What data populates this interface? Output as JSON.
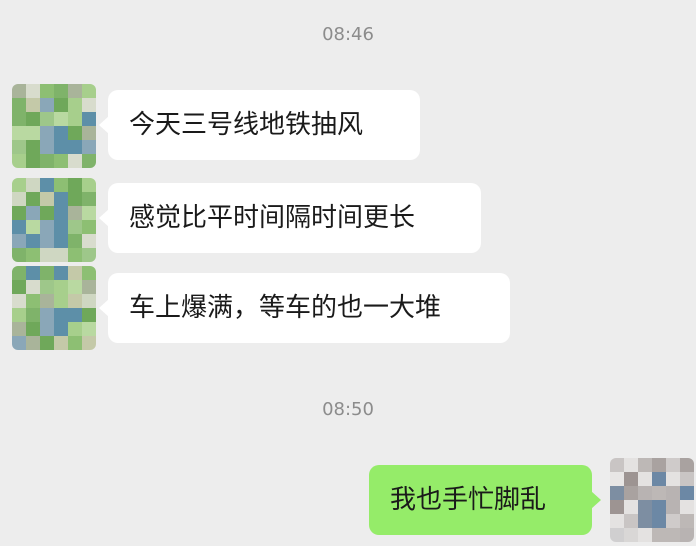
{
  "chat": {
    "timestamps": [
      "08:46",
      "08:50"
    ],
    "messages": [
      {
        "sender": "other",
        "text": "今天三号线地铁抽风"
      },
      {
        "sender": "other",
        "text": "感觉比平时间隔时间更长"
      },
      {
        "sender": "other",
        "text": "车上爆满，等车的也一大堆"
      },
      {
        "sender": "self",
        "text": "我也手忙脚乱"
      }
    ]
  },
  "colors": {
    "background": "#ededed",
    "incoming_bubble": "#ffffff",
    "outgoing_bubble": "#95ec69",
    "timestamp_text": "#8c8c8c"
  },
  "icons": {
    "contact_avatar": "pixelated-avatar-icon",
    "self_avatar": "pixelated-avatar-icon"
  }
}
